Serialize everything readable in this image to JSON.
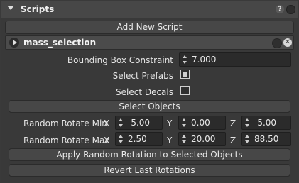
{
  "panel": {
    "title": "Scripts",
    "help_glyph": "?"
  },
  "add_script_label": "Add New Script",
  "script": {
    "name": "mass_selection",
    "close_glyph": "✕"
  },
  "bounding_box": {
    "label": "Bounding Box Constraint",
    "value": "7.000"
  },
  "select_prefabs": {
    "label": "Select Prefabs",
    "checked": true
  },
  "select_decals": {
    "label": "Select Decals",
    "checked": false
  },
  "select_objects_label": "Select Objects",
  "rotate_min": {
    "label": "Random Rotate Min",
    "x_axis": "X",
    "y_axis": "Y",
    "z_axis": "Z",
    "x": "-5.00",
    "y": "0.00",
    "z": "-5.00"
  },
  "rotate_max": {
    "label": "Random Rotate Max",
    "x_axis": "X",
    "y_axis": "Y",
    "z_axis": "Z",
    "x": "2.50",
    "y": "20.00",
    "z": "88.50"
  },
  "apply_label": "Apply Random Rotation to Selected Objects",
  "revert_label": "Revert Last Rotations"
}
